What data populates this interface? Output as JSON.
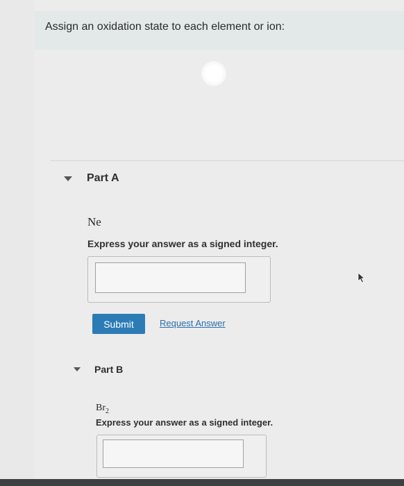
{
  "intro": {
    "text": "Assign an oxidation state to each element or ion:"
  },
  "parts": [
    {
      "label": "Part A",
      "species": "Ne",
      "instruction": "Express your answer as a signed integer.",
      "answer_value": "",
      "submit_label": "Submit",
      "request_label": "Request Answer"
    },
    {
      "label": "Part B",
      "species_base": "Br",
      "species_sub": "2",
      "instruction": "Express your answer as a signed integer.",
      "answer_value": ""
    }
  ],
  "colors": {
    "submit_bg": "#2c7bb5",
    "link": "#2a6fa8",
    "intro_bg": "#e2e9e8"
  },
  "icons": {
    "collapse": "triangle-down",
    "cursor": "arrow-pointer"
  }
}
